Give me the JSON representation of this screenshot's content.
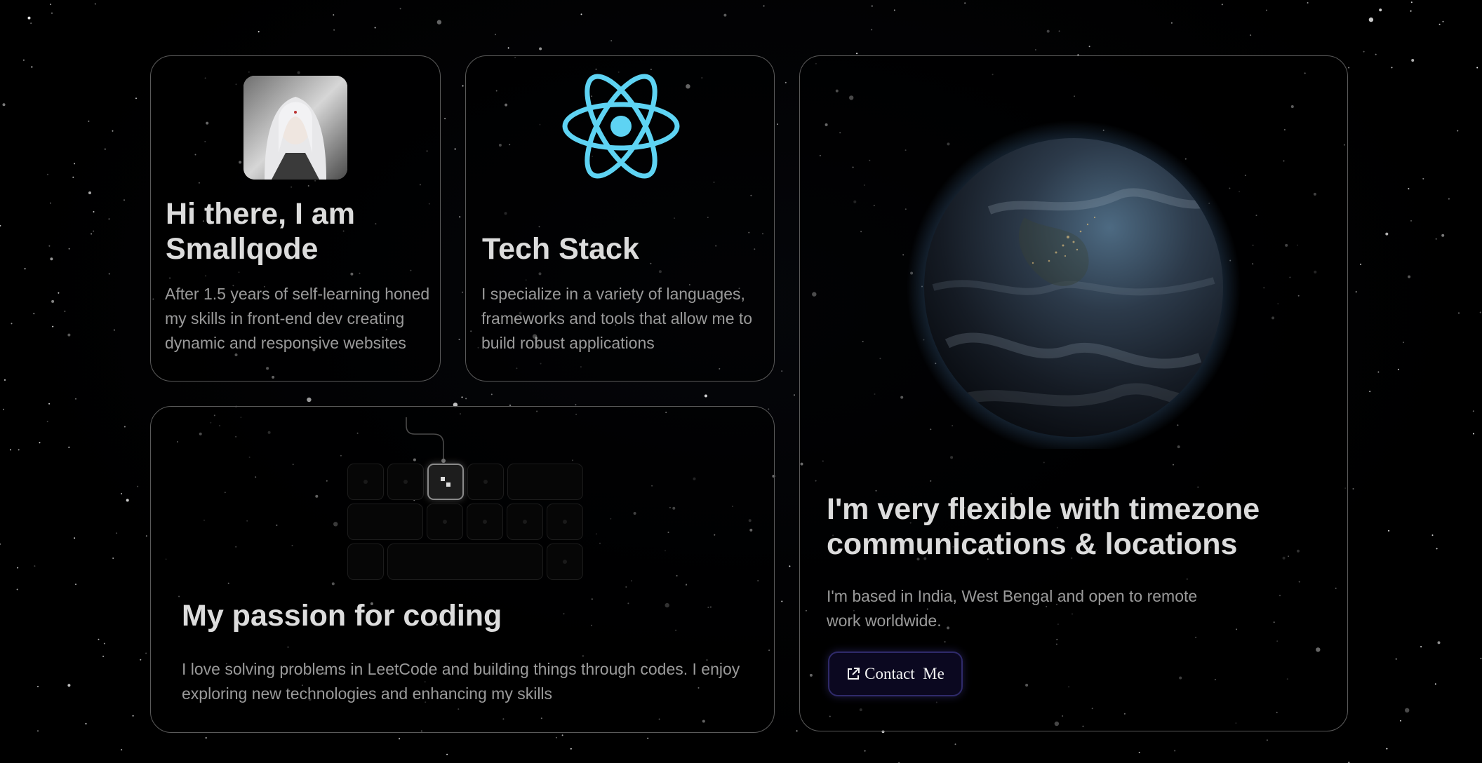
{
  "intro": {
    "heading_line1": "Hi there, I am",
    "heading_line2": "Smallqode",
    "description_line1": "After 1.5 years of self-learning honed",
    "description_line2": "my skills in front-end dev creating",
    "description_line3": "dynamic and responsive websites"
  },
  "tech_stack": {
    "heading": "Tech Stack",
    "description_line1": "I specialize in a variety of languages,",
    "description_line2": "frameworks and tools that allow me to",
    "description_line3": "build robust applications",
    "logo_icon": "react-logo-icon",
    "logo_color": "#5ed3f3"
  },
  "location": {
    "heading_line1": "I'm very flexible with timezone",
    "heading_line2": "communications & locations",
    "description_line1": "I'm based in India, West Bengal and open to remote",
    "description_line2": "work worldwide.",
    "globe_icon": "earth-globe-image",
    "contact_button_label": "Contact  Me",
    "contact_button_icon": "external-link-icon"
  },
  "passion": {
    "heading": "My passion for coding",
    "description_line1": "I love solving problems in LeetCode and building things through codes. I enjoy",
    "description_line2": "exploring new technologies and enhancing my skills",
    "keyboard_icon": "keyboard-grid-icon"
  },
  "colors": {
    "background": "#000000",
    "card_border": "#5a5a5a",
    "heading": "#dcdcdc",
    "body": "#9a9a9a",
    "button_bg": "#0b0820",
    "button_border": "#2f2a6a"
  }
}
